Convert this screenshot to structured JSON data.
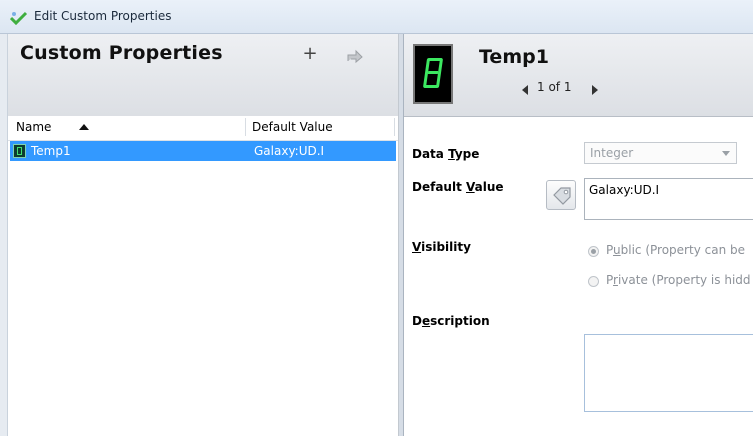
{
  "window": {
    "title": "Edit Custom Properties",
    "icon": "checkmark-wand-icon"
  },
  "left_panel": {
    "title": "Custom Properties",
    "add_icon": "plus-icon",
    "promote_icon": "promote-icon",
    "columns": {
      "name": "Name",
      "default": "Default Value",
      "sort": "ascending"
    },
    "rows": [
      {
        "name": "Temp1",
        "default_value": "Galaxy:UD.I",
        "icon": "seven-segment-icon",
        "selected": true
      }
    ]
  },
  "details": {
    "title": "Temp1",
    "icon": "seven-segment-display-icon",
    "nav": {
      "count": "1 of 1"
    },
    "data_type": {
      "pre": "Data ",
      "acc": "T",
      "post": "ype",
      "value": "Integer"
    },
    "default_value": {
      "pre": "Default ",
      "acc": "V",
      "post": "alue",
      "value": "Galaxy:UD.I",
      "browse_icon": "tag-icon"
    },
    "visibility": {
      "pre": "",
      "acc": "V",
      "post": "isibility",
      "public_pre": "P",
      "public_acc": "u",
      "public_post": "blic (Property can be",
      "private_pre": "P",
      "private_acc": "r",
      "private_post": "ivate (Property is hidd",
      "selected": "public"
    },
    "description": {
      "pre": "D",
      "acc": "e",
      "post": "scription",
      "value": ""
    }
  }
}
